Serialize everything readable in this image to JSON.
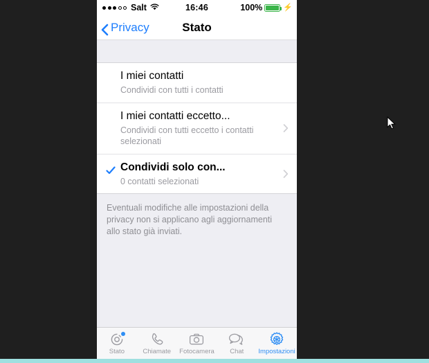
{
  "statusbar": {
    "signal_filled": 3,
    "signal_empty": 2,
    "carrier": "Salt",
    "wifi_icon": "wifi-icon",
    "time": "16:46",
    "battery_percent": "100%",
    "battery_icon": "battery-charging-icon",
    "charging_icon": "lightning-bolt-icon"
  },
  "navbar": {
    "back_label": "Privacy",
    "back_icon": "chevron-left-icon",
    "title": "Stato"
  },
  "list": {
    "rows": [
      {
        "title": "I miei contatti",
        "subtitle": "Condividi con tutti i contatti",
        "selected": false,
        "has_chevron": false
      },
      {
        "title": "I miei contatti eccetto...",
        "subtitle": "Condividi con tutti eccetto i contatti selezionati",
        "selected": false,
        "has_chevron": true
      },
      {
        "title": "Condividi solo con...",
        "subtitle": "0 contatti selezionati",
        "selected": true,
        "has_chevron": true
      }
    ]
  },
  "footnote": "Eventuali modifiche alle impostazioni della privacy non si applicano agli aggiornamenti allo stato già inviati.",
  "tabbar": {
    "tabs": [
      {
        "label": "Stato",
        "icon": "status-rings-icon",
        "active": false,
        "badge": true
      },
      {
        "label": "Chiamate",
        "icon": "phone-handset-icon",
        "active": false,
        "badge": false
      },
      {
        "label": "Fotocamera",
        "icon": "camera-icon",
        "active": false,
        "badge": false
      },
      {
        "label": "Chat",
        "icon": "chat-bubbles-icon",
        "active": false,
        "badge": false
      },
      {
        "label": "Impostazioni",
        "icon": "gear-icon",
        "active": true,
        "badge": false
      }
    ]
  },
  "colors": {
    "accent_blue": "#1d7efd",
    "tab_active_blue": "#2f8ef4",
    "battery_green": "#3bb54a",
    "desktop_background": "#1f1f1f",
    "bottom_strip_teal": "#9fe0e0"
  }
}
